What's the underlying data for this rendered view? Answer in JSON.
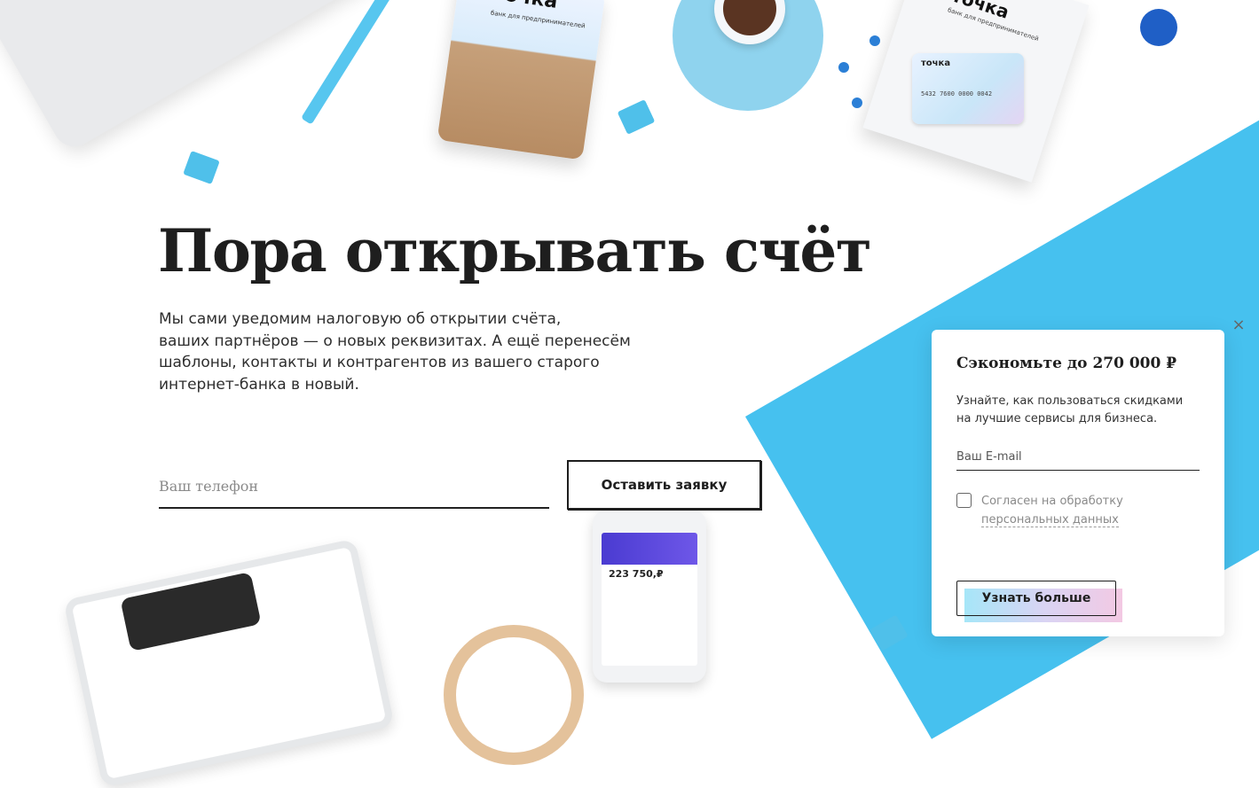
{
  "brand": {
    "name": "точка",
    "tagline": "банк для предпринимателей"
  },
  "decor": {
    "card_number": "5432 7600 0000 0042",
    "phone_balance": "223 750,₽"
  },
  "hero": {
    "headline": "Пора открывать счёт",
    "lead_lines": [
      "Мы сами уведомим налоговую об открытии счёта,",
      "ваших партнёров — о новых реквизитах. А ещё перенесём",
      "шаблоны, контакты и контрагентов из вашего старого",
      "интернет-банка в новый."
    ]
  },
  "form": {
    "phone_placeholder": "Ваш телефон",
    "phone_value": "",
    "submit_label": "Оставить заявку"
  },
  "popup": {
    "close_glyph": "×",
    "title": "Сэкономьте до 270 000 ₽",
    "desc_lines": [
      "Узнайте, как пользоваться скидками",
      "на лучшие сервисы для бизнеса."
    ],
    "email_placeholder": "Ваш E-mail",
    "email_value": "",
    "consent_text": "Согласен на обработку",
    "consent_link": "персональных данных",
    "consent_checked": false,
    "button_label": "Узнать больше"
  },
  "colors": {
    "accent_cyan": "#46c1ef",
    "text_dark": "#1e1e1e",
    "muted": "#8a8a8a"
  }
}
